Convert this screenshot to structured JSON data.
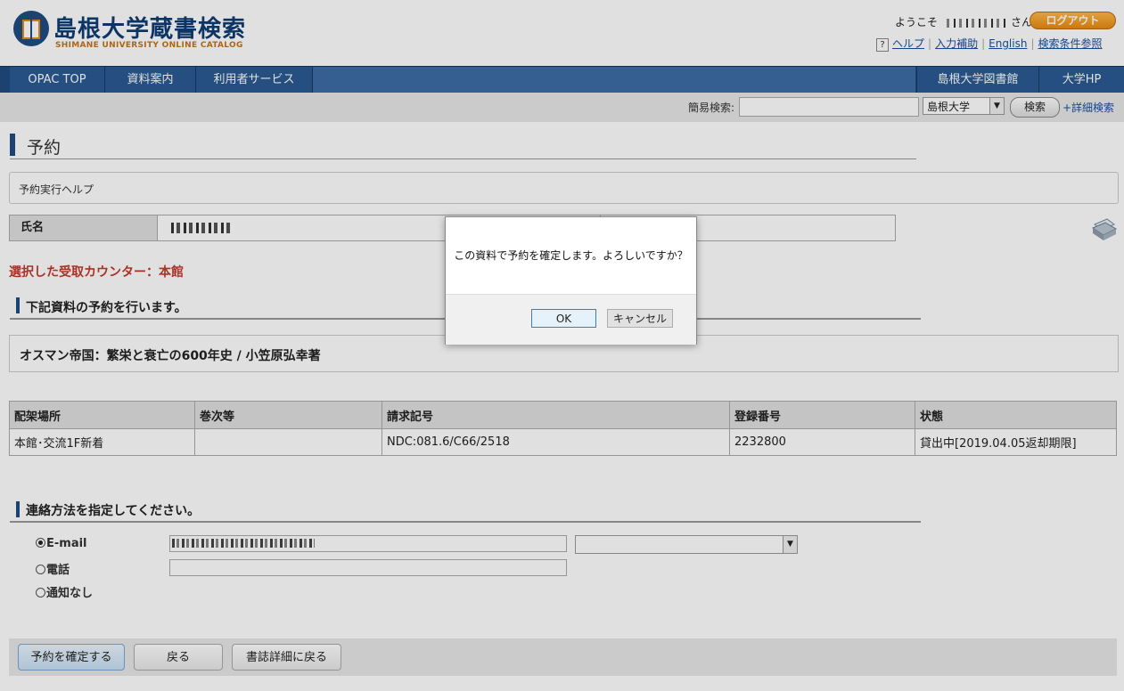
{
  "header": {
    "title": "島根大学蔵書検索",
    "subtitle": "SHIMANE UNIVERSITY ONLINE CATALOG",
    "welcome_prefix": "ようこそ",
    "welcome_suffix": "さん",
    "logout": "ログアウト",
    "help_glyph": "?",
    "links": [
      "ヘルプ",
      "入力補助",
      "English",
      "検索条件参照"
    ]
  },
  "nav": {
    "left": [
      "OPAC TOP",
      "資料案内",
      "利用者サービス"
    ],
    "right": [
      "島根大学図書館",
      "大学HP"
    ]
  },
  "quick_search": {
    "label": "簡易検索:",
    "input_value": "",
    "scope": "島根大学",
    "button": "検索",
    "advanced": "+詳細検索"
  },
  "page": {
    "title": "予約",
    "help_text": "予約実行ヘルプ",
    "name_label": "氏名",
    "counter_text": "選択した受取カウンター：本館",
    "section1": "下記資料の予約を行います。",
    "book_title": "オスマン帝国：繁栄と衰亡の600年史 / 小笠原弘幸著",
    "table": {
      "headers": [
        "配架場所",
        "巻次等",
        "請求記号",
        "登録番号",
        "状態"
      ],
      "row": [
        "本館･交流1F新着",
        "",
        "NDC:081.6/C66/2518",
        "2232800",
        "貸出中[2019.04.05返却期限]"
      ]
    },
    "section2": "連絡方法を指定してください。",
    "contact": {
      "email": "E-mail",
      "phone": "電話",
      "none": "通知なし"
    }
  },
  "buttons": {
    "confirm": "予約を確定する",
    "back": "戻る",
    "back_detail": "書誌詳細に戻る"
  },
  "dialog": {
    "message": "この資料で予約を確定します。よろしいですか？",
    "ok": "OK",
    "cancel": "キャンセル"
  },
  "colors": {
    "nav_bg": "#1f4c80",
    "accent_orange": "#e98a10",
    "counter_red": "#c0392b",
    "link_blue": "#1a4e9c"
  }
}
